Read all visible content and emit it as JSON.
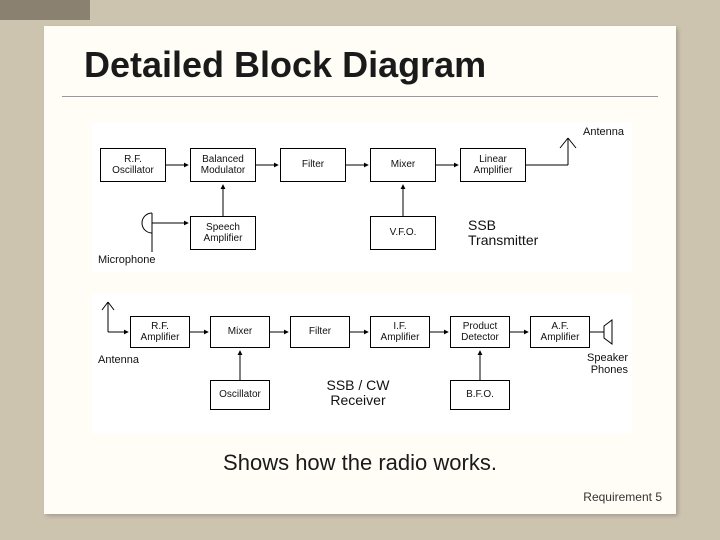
{
  "title": "Detailed Block Diagram",
  "caption": "Shows how the radio works.",
  "requirement": "Requirement 5",
  "tx": {
    "antenna": "Antenna",
    "mic": "Microphone",
    "label": "SSB\nTransmitter",
    "blocks": {
      "rfosc": "R.F.\nOscillator",
      "balmod": "Balanced\nModulator",
      "filter": "Filter",
      "mixer": "Mixer",
      "linamp": "Linear\nAmplifier",
      "spamp": "Speech\nAmplifier",
      "vfo": "V.F.O."
    }
  },
  "rx": {
    "antenna": "Antenna",
    "speaker": "Speaker\nPhones",
    "label": "SSB / CW\nReceiver",
    "blocks": {
      "rfamp": "R.F.\nAmplifier",
      "mixer": "Mixer",
      "filter": "Filter",
      "ifamp": "I.F.\nAmplifier",
      "proddet": "Product\nDetector",
      "afamp": "A.F.\nAmplifier",
      "osc": "Oscillator",
      "bfo": "B.F.O."
    }
  }
}
